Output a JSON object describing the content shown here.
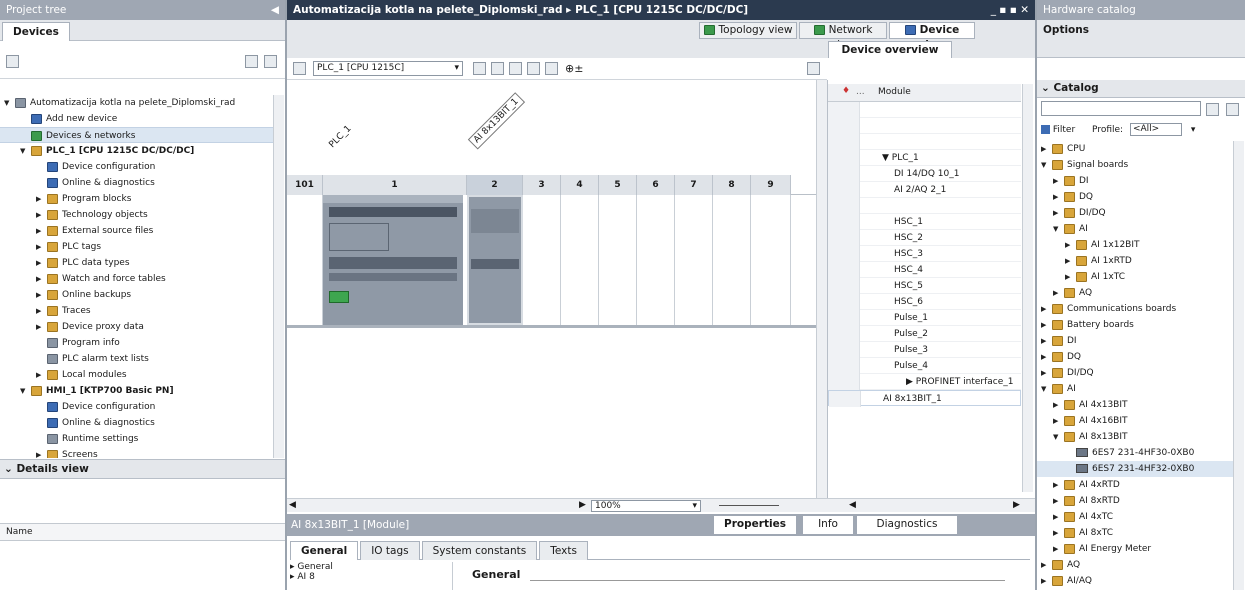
{
  "project_tree": {
    "title": "Project tree",
    "devices_tab": "Devices",
    "items": [
      {
        "label": "Automatizacija kotla na pelete_Diplomski_rad",
        "indent": 0,
        "arrow": "▼",
        "icon": "gray",
        "icon_name": "project-icon"
      },
      {
        "label": "Add new device",
        "indent": 1,
        "arrow": "",
        "icon": "blue",
        "icon_name": "add-device-icon"
      },
      {
        "label": "Devices & networks",
        "indent": 1,
        "arrow": "",
        "icon": "green",
        "icon_name": "network-icon"
      },
      {
        "label": "PLC_1 [CPU 1215C DC/DC/DC]",
        "indent": 1,
        "arrow": "▼",
        "icon": "folder",
        "icon_name": "plc-icon",
        "bold": true
      },
      {
        "label": "Device configuration",
        "indent": 2,
        "arrow": "",
        "icon": "blue",
        "icon_name": "device-config-icon"
      },
      {
        "label": "Online & diagnostics",
        "indent": 2,
        "arrow": "",
        "icon": "blue",
        "icon_name": "diagnostics-icon"
      },
      {
        "label": "Program blocks",
        "indent": 2,
        "arrow": "▶",
        "icon": "folder",
        "icon_name": "folder-icon"
      },
      {
        "label": "Technology objects",
        "indent": 2,
        "arrow": "▶",
        "icon": "folder",
        "icon_name": "folder-icon"
      },
      {
        "label": "External source files",
        "indent": 2,
        "arrow": "▶",
        "icon": "folder",
        "icon_name": "folder-icon"
      },
      {
        "label": "PLC tags",
        "indent": 2,
        "arrow": "▶",
        "icon": "folder",
        "icon_name": "folder-icon"
      },
      {
        "label": "PLC data types",
        "indent": 2,
        "arrow": "▶",
        "icon": "folder",
        "icon_name": "folder-icon"
      },
      {
        "label": "Watch and force tables",
        "indent": 2,
        "arrow": "▶",
        "icon": "folder",
        "icon_name": "folder-icon"
      },
      {
        "label": "Online backups",
        "indent": 2,
        "arrow": "▶",
        "icon": "folder",
        "icon_name": "folder-icon"
      },
      {
        "label": "Traces",
        "indent": 2,
        "arrow": "▶",
        "icon": "folder",
        "icon_name": "folder-icon"
      },
      {
        "label": "Device proxy data",
        "indent": 2,
        "arrow": "▶",
        "icon": "folder",
        "icon_name": "folder-icon"
      },
      {
        "label": "Program info",
        "indent": 2,
        "arrow": "",
        "icon": "gray",
        "icon_name": "info-icon"
      },
      {
        "label": "PLC alarm text lists",
        "indent": 2,
        "arrow": "",
        "icon": "gray",
        "icon_name": "list-icon"
      },
      {
        "label": "Local modules",
        "indent": 2,
        "arrow": "▶",
        "icon": "folder",
        "icon_name": "folder-icon"
      },
      {
        "label": "HMI_1 [KTP700 Basic PN]",
        "indent": 1,
        "arrow": "▼",
        "icon": "folder",
        "icon_name": "hmi-icon",
        "bold": true
      },
      {
        "label": "Device configuration",
        "indent": 2,
        "arrow": "",
        "icon": "blue",
        "icon_name": "device-config-icon"
      },
      {
        "label": "Online & diagnostics",
        "indent": 2,
        "arrow": "",
        "icon": "blue",
        "icon_name": "diagnostics-icon"
      },
      {
        "label": "Runtime settings",
        "indent": 2,
        "arrow": "",
        "icon": "gray",
        "icon_name": "settings-icon"
      },
      {
        "label": "Screens",
        "indent": 2,
        "arrow": "▶",
        "icon": "folder",
        "icon_name": "folder-icon"
      }
    ],
    "details_title": "Details view",
    "details_col": "Name"
  },
  "editor": {
    "title": "Automatizacija kotla na pelete_Diplomski_rad ▸ PLC_1 [CPU 1215C DC/DC/DC]",
    "topology_tab": "Topology view",
    "network_tab": "Network view",
    "device_tab": "Device view",
    "device_select": "PLC_1 [CPU 1215C]",
    "label_plc": "PLC_1",
    "label_ai": "AI 8x13BIT_1",
    "rack_slots": [
      "101",
      "1",
      "2",
      "3",
      "4",
      "5",
      "6",
      "7",
      "8",
      "9"
    ],
    "zoom": "100%"
  },
  "overview": {
    "tab": "Device overview",
    "col_module": "Module",
    "rows": [
      {
        "text": "",
        "indent": 0
      },
      {
        "text": "",
        "indent": 0
      },
      {
        "text": "",
        "indent": 0
      },
      {
        "text": "▼  PLC_1",
        "indent": 1
      },
      {
        "text": "DI 14/DQ 10_1",
        "indent": 2
      },
      {
        "text": "AI 2/AQ 2_1",
        "indent": 2
      },
      {
        "text": "",
        "indent": 0
      },
      {
        "text": "HSC_1",
        "indent": 2
      },
      {
        "text": "HSC_2",
        "indent": 2
      },
      {
        "text": "HSC_3",
        "indent": 2
      },
      {
        "text": "HSC_4",
        "indent": 2
      },
      {
        "text": "HSC_5",
        "indent": 2
      },
      {
        "text": "HSC_6",
        "indent": 2
      },
      {
        "text": "Pulse_1",
        "indent": 2
      },
      {
        "text": "Pulse_2",
        "indent": 2
      },
      {
        "text": "Pulse_3",
        "indent": 2
      },
      {
        "text": "Pulse_4",
        "indent": 2
      },
      {
        "text": "▶  PROFINET interface_1",
        "indent": 3
      },
      {
        "text": "AI 8x13BIT_1",
        "indent": 1,
        "sel": true
      }
    ]
  },
  "properties": {
    "title": "AI 8x13BIT_1 [Module]",
    "properties_tab": "Properties",
    "info_tab": "Info",
    "diagnostics_tab": "Diagnostics",
    "tabs": [
      "General",
      "IO tags",
      "System constants",
      "Texts"
    ],
    "nav": [
      "General",
      "AI 8"
    ],
    "section": "General"
  },
  "catalog": {
    "title": "Hardware catalog",
    "options": "Options",
    "catalog_label": "Catalog",
    "filter_label": "Filter",
    "profile_label": "Profile:",
    "profile_value": "<All>",
    "items": [
      {
        "label": "CPU",
        "indent": 0,
        "arrow": "▶",
        "chip": false
      },
      {
        "label": "Signal boards",
        "indent": 0,
        "arrow": "▼",
        "chip": false
      },
      {
        "label": "DI",
        "indent": 1,
        "arrow": "▶",
        "chip": false
      },
      {
        "label": "DQ",
        "indent": 1,
        "arrow": "▶",
        "chip": false
      },
      {
        "label": "DI/DQ",
        "indent": 1,
        "arrow": "▶",
        "chip": false
      },
      {
        "label": "AI",
        "indent": 1,
        "arrow": "▼",
        "chip": false
      },
      {
        "label": "AI 1x12BIT",
        "indent": 2,
        "arrow": "▶",
        "chip": false
      },
      {
        "label": "AI 1xRTD",
        "indent": 2,
        "arrow": "▶",
        "chip": false
      },
      {
        "label": "AI 1xTC",
        "indent": 2,
        "arrow": "▶",
        "chip": false
      },
      {
        "label": "AQ",
        "indent": 1,
        "arrow": "▶",
        "chip": false
      },
      {
        "label": "Communications boards",
        "indent": 0,
        "arrow": "▶",
        "chip": false
      },
      {
        "label": "Battery boards",
        "indent": 0,
        "arrow": "▶",
        "chip": false
      },
      {
        "label": "DI",
        "indent": 0,
        "arrow": "▶",
        "chip": false
      },
      {
        "label": "DQ",
        "indent": 0,
        "arrow": "▶",
        "chip": false
      },
      {
        "label": "DI/DQ",
        "indent": 0,
        "arrow": "▶",
        "chip": false
      },
      {
        "label": "AI",
        "indent": 0,
        "arrow": "▼",
        "chip": false
      },
      {
        "label": "AI 4x13BIT",
        "indent": 1,
        "arrow": "▶",
        "chip": false
      },
      {
        "label": "AI 4x16BIT",
        "indent": 1,
        "arrow": "▶",
        "chip": false
      },
      {
        "label": "AI 8x13BIT",
        "indent": 1,
        "arrow": "▼",
        "chip": false
      },
      {
        "label": "6ES7 231-4HF30-0XB0",
        "indent": 2,
        "arrow": "",
        "chip": true
      },
      {
        "label": "6ES7 231-4HF32-0XB0",
        "indent": 2,
        "arrow": "",
        "chip": true,
        "sel": true
      },
      {
        "label": "AI 4xRTD",
        "indent": 1,
        "arrow": "▶",
        "chip": false
      },
      {
        "label": "AI 8xRTD",
        "indent": 1,
        "arrow": "▶",
        "chip": false
      },
      {
        "label": "AI 4xTC",
        "indent": 1,
        "arrow": "▶",
        "chip": false
      },
      {
        "label": "AI 8xTC",
        "indent": 1,
        "arrow": "▶",
        "chip": false
      },
      {
        "label": "AI Energy Meter",
        "indent": 1,
        "arrow": "▶",
        "chip": false
      },
      {
        "label": "AQ",
        "indent": 0,
        "arrow": "▶",
        "chip": false
      },
      {
        "label": "AI/AQ",
        "indent": 0,
        "arrow": "▶",
        "chip": false
      }
    ]
  }
}
